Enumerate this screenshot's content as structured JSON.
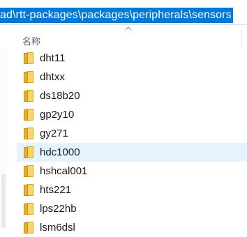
{
  "address_bar": {
    "path": "ad\\rtt-packages\\packages\\peripherals\\sensors"
  },
  "column_header": {
    "name_label": "名称",
    "sort_icon": "chevron-up-icon"
  },
  "files": [
    {
      "name": "dht11",
      "icon": "folder-icon"
    },
    {
      "name": "dhtxx",
      "icon": "folder-icon"
    },
    {
      "name": "ds18b20",
      "icon": "folder-icon"
    },
    {
      "name": "gp2y10",
      "icon": "folder-icon"
    },
    {
      "name": "gy271",
      "icon": "folder-icon"
    },
    {
      "name": "hdc1000",
      "icon": "folder-icon"
    },
    {
      "name": "hshcal001",
      "icon": "folder-icon"
    },
    {
      "name": "hts221",
      "icon": "folder-icon"
    },
    {
      "name": "lps22hb",
      "icon": "folder-icon"
    },
    {
      "name": "lsm6dsl",
      "icon": "folder-icon"
    }
  ],
  "selected_index": 5,
  "colors": {
    "selection_highlight": "#0078d7",
    "row_selected": "#e5f3ff",
    "folder": "#f0c040"
  }
}
